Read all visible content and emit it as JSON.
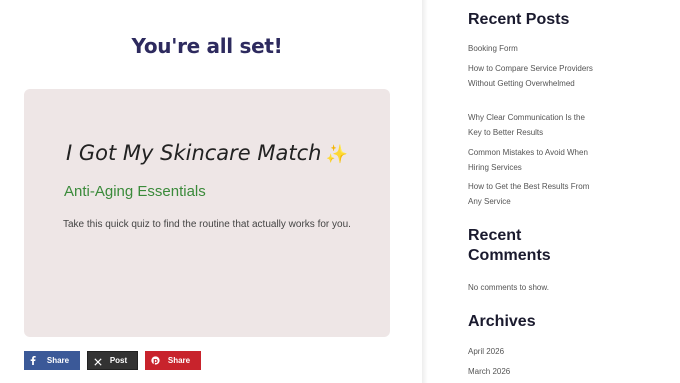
{
  "main": {
    "title": "You're all set!",
    "card": {
      "heading": "I Got My Skincare Match",
      "sparkle": "✨",
      "subheading": "Anti-Aging Essentials",
      "text": "Take this quick quiz to find the routine that actually works for you."
    },
    "share": {
      "facebook_label": "Share",
      "x_label": "Post",
      "pinterest_label": "Share"
    }
  },
  "sidebar": {
    "recent_posts": {
      "title": "Recent Posts",
      "items": [
        "Booking Form",
        "How to Compare Service Providers Without Getting Overwhelmed",
        "Why Clear Communication Is the Key to Better Results",
        "Common Mistakes to Avoid When Hiring Services",
        "How to Get the Best Results From Any Service"
      ]
    },
    "recent_comments": {
      "title_line1": "Recent",
      "title_line2": "Comments",
      "empty_text": "No comments to show."
    },
    "archives": {
      "title": "Archives",
      "items": [
        "April 2026",
        "March 2026"
      ]
    }
  },
  "colors": {
    "title": "#2d2a5e",
    "card_bg": "#eee6e6",
    "subheading": "#3a8a3a",
    "facebook": "#3b5998",
    "x": "#333333",
    "pinterest": "#c8232c"
  }
}
